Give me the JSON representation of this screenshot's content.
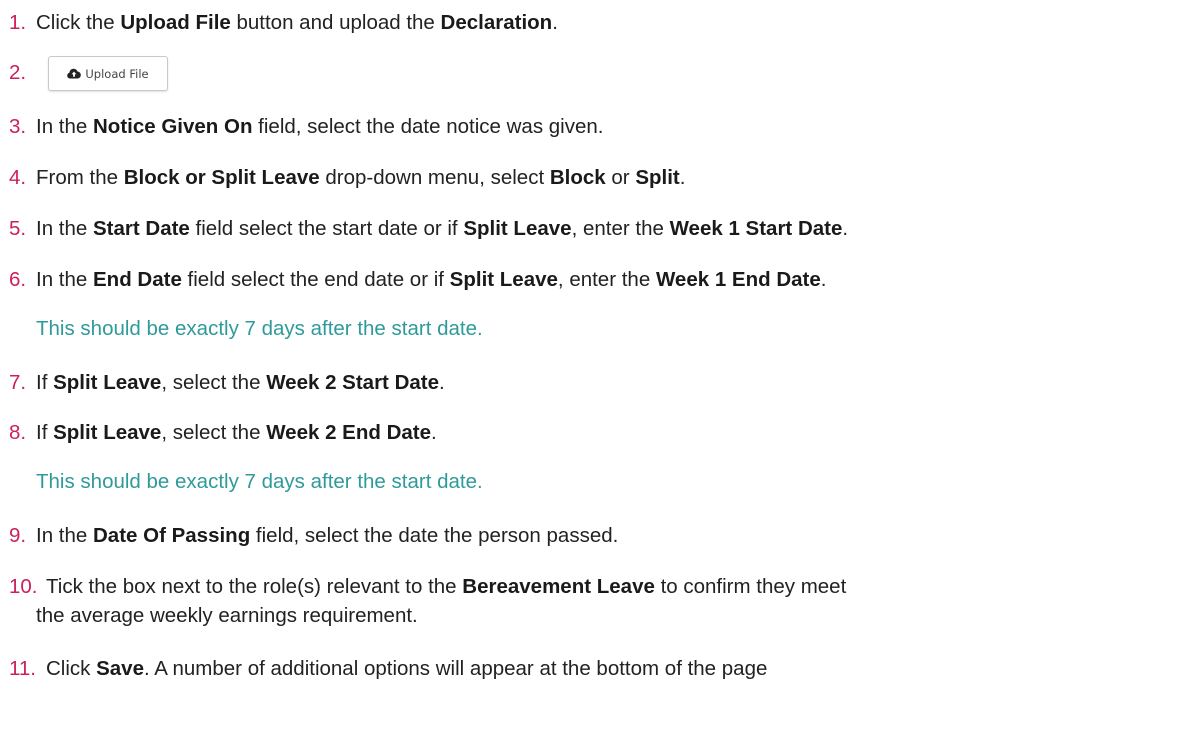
{
  "steps": [
    {
      "num": "1.",
      "parts": [
        "Click the ",
        "Upload File",
        " button and upload the ",
        "Declaration",
        "."
      ]
    },
    {
      "num": "2."
    },
    {
      "num": "3.",
      "parts": [
        "In the ",
        "Notice Given On",
        " field, select the date notice was given."
      ]
    },
    {
      "num": "4.",
      "parts": [
        "From the ",
        "Block or Split Leave",
        " drop-down menu, select ",
        "Block",
        " or ",
        "Split",
        "."
      ]
    },
    {
      "num": "5.",
      "parts": [
        "In the ",
        "Start Date",
        " field select the start date or if ",
        "Split Leave",
        ", enter the ",
        "Week 1 Start Date",
        "."
      ]
    },
    {
      "num": "6.",
      "parts": [
        "In the ",
        "End Date",
        " field select the end date or if ",
        "Split Leave",
        ", enter the ",
        "Week 1 End Date",
        "."
      ],
      "note": "This should be exactly 7 days after the start date."
    },
    {
      "num": "7.",
      "parts": [
        "If ",
        "Split Leave",
        ", select the ",
        "Week 2 Start Date",
        "."
      ]
    },
    {
      "num": "8.",
      "parts": [
        "If ",
        "Split Leave",
        ", select the ",
        "Week 2 End Date",
        "."
      ],
      "note": "This should be exactly 7 days after the start date."
    },
    {
      "num": "9.",
      "parts": [
        "In the ",
        "Date Of Passing",
        " field, select the date the person passed."
      ]
    },
    {
      "num": "10.",
      "parts": [
        "Tick the box next to the role(s) relevant to the ",
        "Bereavement Leave",
        " to confirm they meet"
      ],
      "continuation": "the average weekly earnings requirement."
    },
    {
      "num": "11.",
      "parts": [
        "Click ",
        "Save",
        ". A number of additional options will appear at the bottom of the page"
      ]
    }
  ],
  "upload_button": {
    "label": "Upload File",
    "icon": "cloud-upload-icon"
  },
  "colors": {
    "number": "#cc1f5c",
    "note": "#2f9a9a",
    "text": "#222222"
  }
}
